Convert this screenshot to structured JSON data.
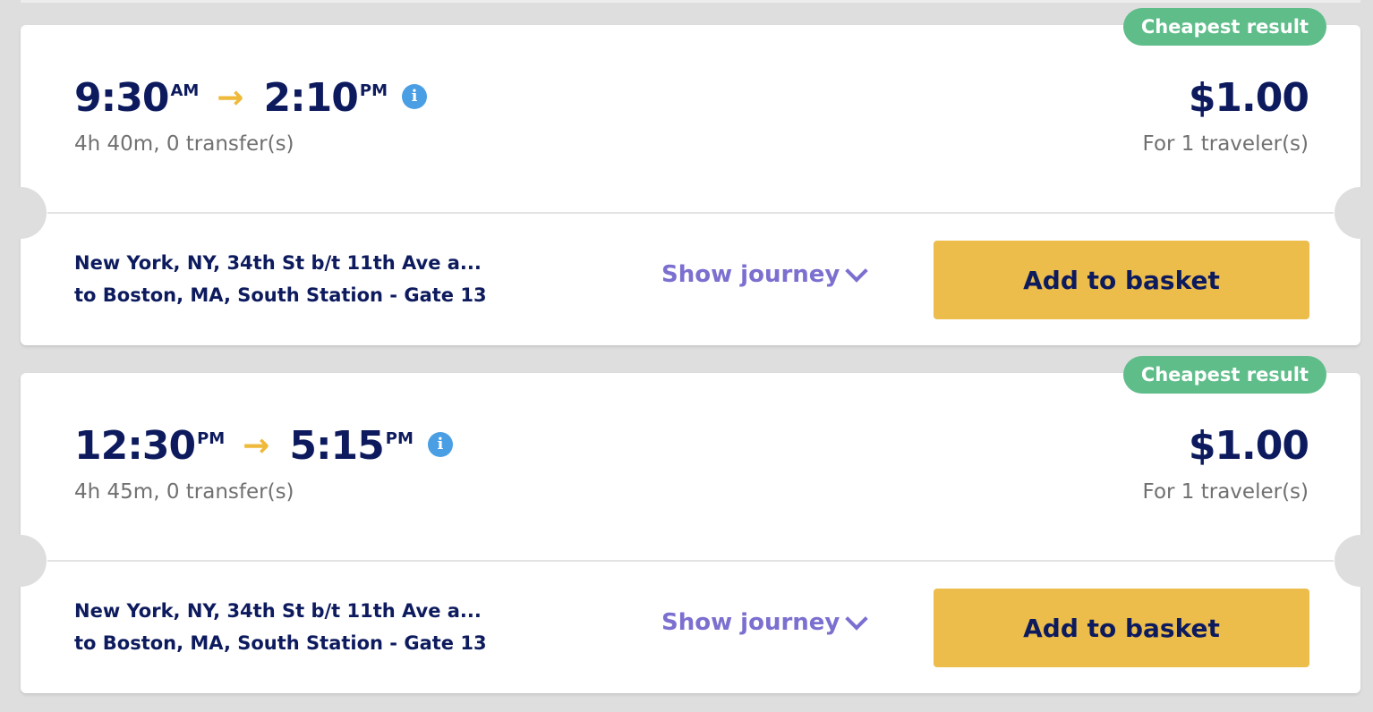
{
  "colors": {
    "navy": "#0d1b5e",
    "badge_green": "#5fbd8a",
    "arrow_yellow": "#efb93a",
    "info_blue": "#4a9fe4",
    "link_purple": "#7b6fd0",
    "button_yellow": "#ecbd4b"
  },
  "results": [
    {
      "badge": "Cheapest result",
      "departure_time": "9:30",
      "departure_ampm": "AM",
      "arrival_time": "2:10",
      "arrival_ampm": "PM",
      "arrow_icon": "→",
      "info_icon": "i",
      "duration": "4h 40m, 0 transfer(s)",
      "price": "$1.00",
      "travelers": "For 1 traveler(s)",
      "route_from": "New York, NY, 34th St b/t 11th Ave a...",
      "route_to": "to  Boston, MA, South Station - Gate 13",
      "show_journey": "Show journey",
      "add_to_basket": "Add to basket"
    },
    {
      "badge": "Cheapest result",
      "departure_time": "12:30",
      "departure_ampm": "PM",
      "arrival_time": "5:15",
      "arrival_ampm": "PM",
      "arrow_icon": "→",
      "info_icon": "i",
      "duration": "4h 45m, 0 transfer(s)",
      "price": "$1.00",
      "travelers": "For 1 traveler(s)",
      "route_from": "New York, NY, 34th St b/t 11th Ave a...",
      "route_to": "to  Boston, MA, South Station - Gate 13",
      "show_journey": "Show journey",
      "add_to_basket": "Add to basket"
    }
  ]
}
